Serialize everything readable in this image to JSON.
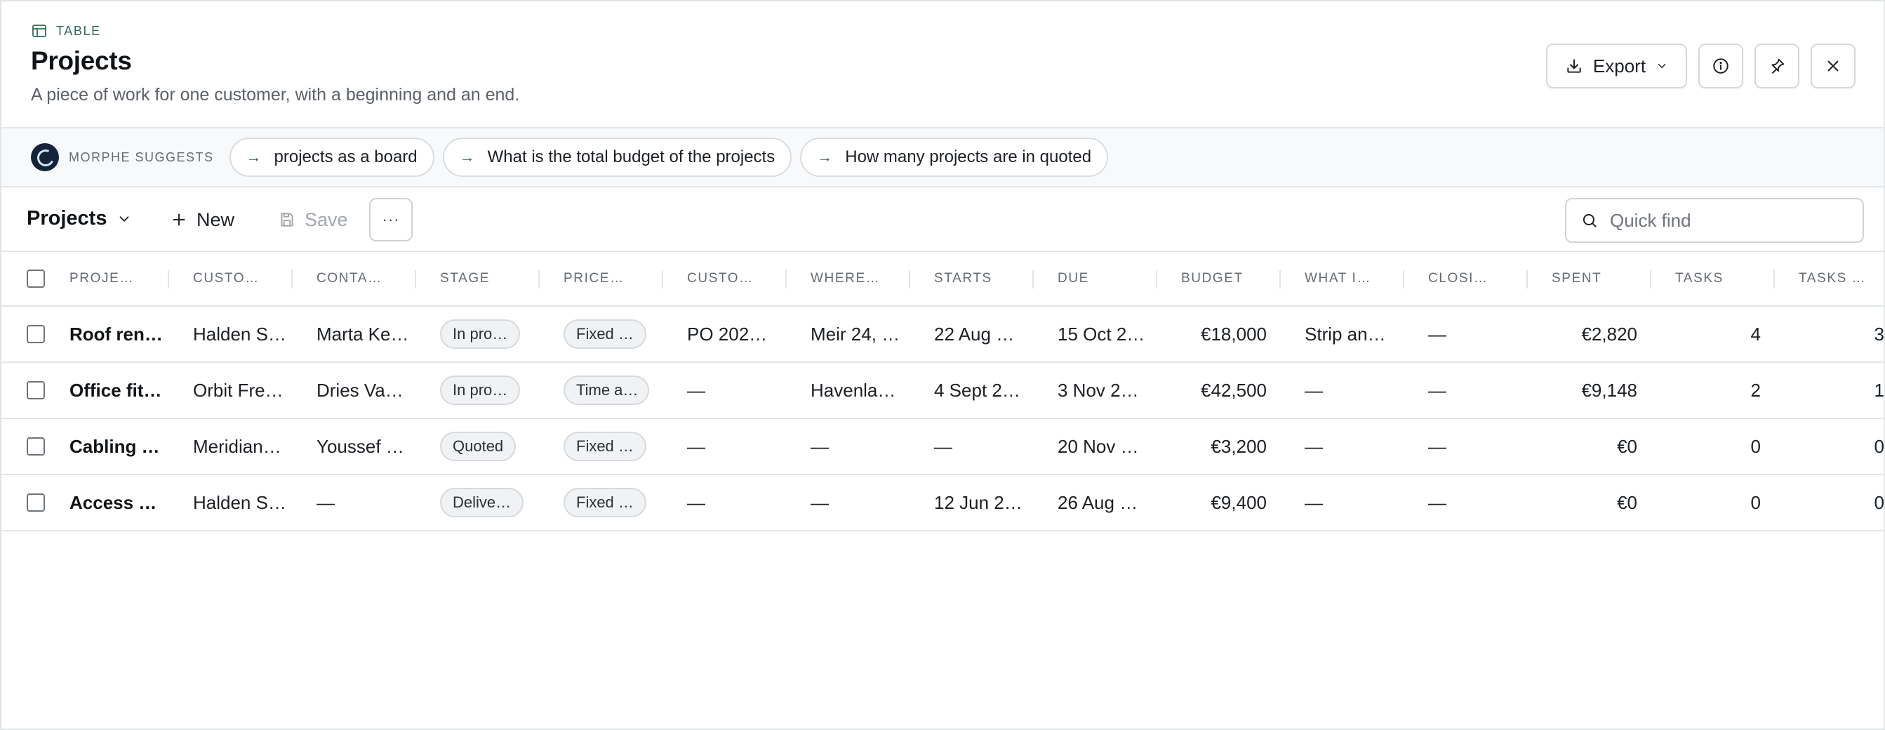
{
  "header": {
    "kind_label": "TABLE",
    "title": "Projects",
    "subtitle": "A piece of work for one customer, with a beginning and an end.",
    "export_label": "Export"
  },
  "suggestions": {
    "label": "MORPHE SUGGESTS",
    "chips": [
      "projects as a board",
      "What is the total budget of the projects",
      "How many projects are in quoted"
    ]
  },
  "toolbar": {
    "view_label": "Projects",
    "new_label": "New",
    "save_label": "Save",
    "more_label": "···",
    "quickfind_placeholder": "Quick find"
  },
  "table": {
    "columns": [
      "PROJE…",
      "CUSTO…",
      "CONTA…",
      "STAGE",
      "PRICE…",
      "CUSTO…",
      "WHERE…",
      "STARTS",
      "DUE",
      "BUDGET",
      "WHAT I…",
      "CLOSI…",
      "SPENT",
      "TASKS",
      "TASKS …"
    ],
    "rows": [
      [
        "Roof ren…",
        "Halden S…",
        "Marta Ke…",
        "In pro…",
        "Fixed …",
        "PO 202…",
        "Meir 24, …",
        "22 Aug …",
        "15 Oct 2…",
        "€18,000",
        "Strip an…",
        "—",
        "€2,820",
        "4",
        "3"
      ],
      [
        "Office fit…",
        "Orbit Fre…",
        "Dries Va…",
        "In pro…",
        "Time a…",
        "—",
        "Havenla…",
        "4 Sept 2…",
        "3 Nov 2…",
        "€42,500",
        "—",
        "—",
        "€9,148",
        "2",
        "1"
      ],
      [
        "Cabling …",
        "Meridian…",
        "Youssef …",
        "Quoted",
        "Fixed …",
        "—",
        "—",
        "—",
        "20 Nov …",
        "€3,200",
        "—",
        "—",
        "€0",
        "0",
        "0"
      ],
      [
        "Access …",
        "Halden S…",
        "—",
        "Delive…",
        "Fixed …",
        "—",
        "—",
        "12 Jun 2…",
        "26 Aug …",
        "€9,400",
        "—",
        "—",
        "€0",
        "0",
        "0"
      ]
    ]
  }
}
